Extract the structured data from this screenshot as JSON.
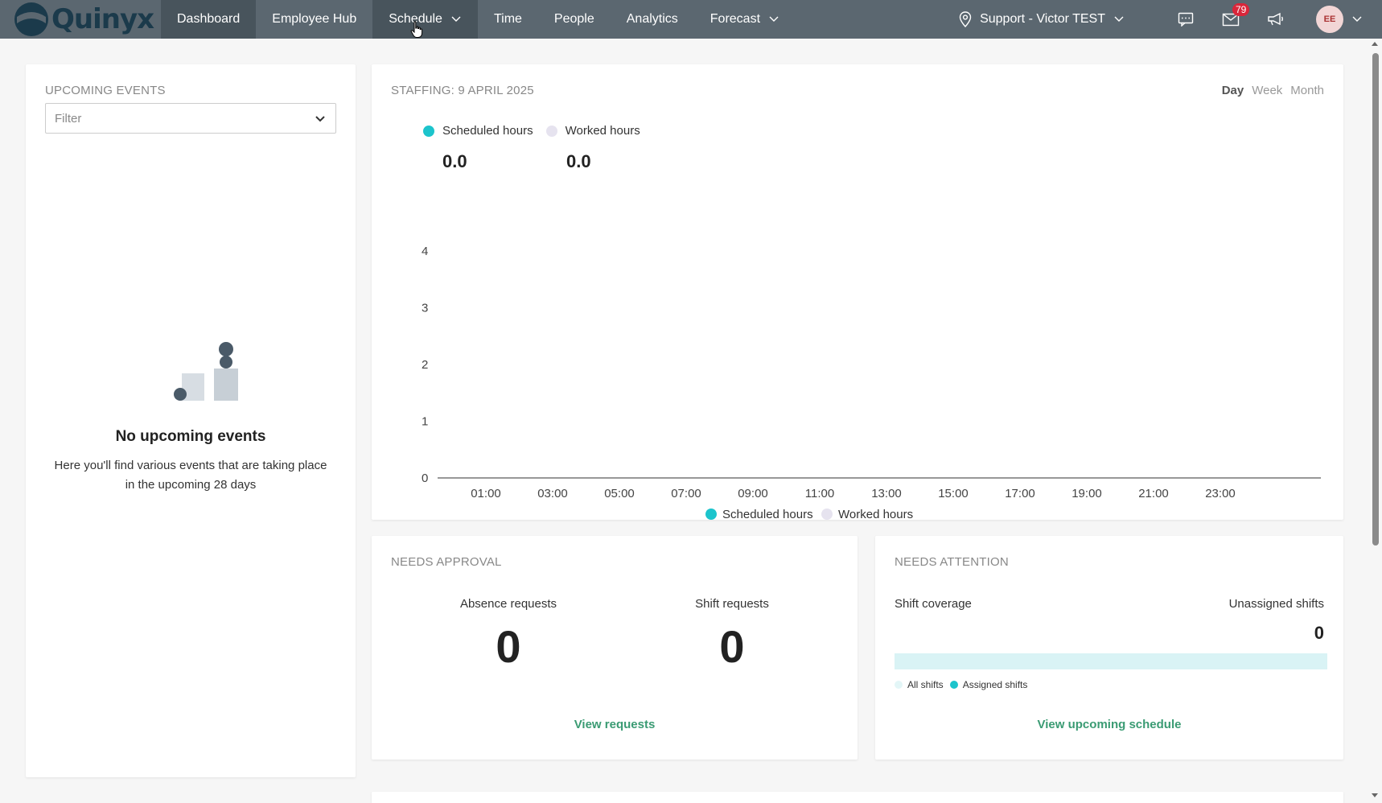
{
  "app": {
    "logo_text": "Quinyx"
  },
  "nav": {
    "items": [
      {
        "label": "Dashboard",
        "active": true,
        "dropdown": false
      },
      {
        "label": "Employee Hub",
        "active": false,
        "dropdown": false
      },
      {
        "label": "Schedule",
        "active": false,
        "dropdown": true
      },
      {
        "label": "Time",
        "active": false,
        "dropdown": false
      },
      {
        "label": "People",
        "active": false,
        "dropdown": false
      },
      {
        "label": "Analytics",
        "active": false,
        "dropdown": false
      },
      {
        "label": "Forecast",
        "active": false,
        "dropdown": true
      }
    ],
    "location": "Support - Victor TEST",
    "messages_badge": "79",
    "avatar_initials": "EE"
  },
  "events": {
    "title": "UPCOMING EVENTS",
    "filter_placeholder": "Filter",
    "empty_title": "No upcoming events",
    "empty_text": "Here you'll find various events that are taking place in the upcoming 28 days"
  },
  "staffing": {
    "title": "STAFFING: 9 APRIL 2025",
    "periods": [
      "Day",
      "Week",
      "Month"
    ],
    "active_period": "Day",
    "legend": [
      {
        "name": "Scheduled hours",
        "color": "#1cc4cc",
        "total": "0.0"
      },
      {
        "name": "Worked hours",
        "color": "#e6e3ef",
        "total": "0.0"
      }
    ]
  },
  "chart_data": {
    "type": "line",
    "title": "",
    "xlabel": "",
    "ylabel": "",
    "x": [
      "01:00",
      "03:00",
      "05:00",
      "07:00",
      "09:00",
      "11:00",
      "13:00",
      "15:00",
      "17:00",
      "19:00",
      "21:00",
      "23:00"
    ],
    "ylim": [
      0,
      4
    ],
    "y_ticks": [
      "0",
      "1",
      "2",
      "3",
      "4"
    ],
    "series": [
      {
        "name": "Scheduled hours",
        "color": "#1cc4cc",
        "values": [
          0,
          0,
          0,
          0,
          0,
          0,
          0,
          0,
          0,
          0,
          0,
          0
        ]
      },
      {
        "name": "Worked hours",
        "color": "#e6e3ef",
        "values": [
          0,
          0,
          0,
          0,
          0,
          0,
          0,
          0,
          0,
          0,
          0,
          0
        ]
      }
    ],
    "legend_position": "bottom",
    "grid": false
  },
  "approval": {
    "title": "NEEDS APPROVAL",
    "absence_label": "Absence requests",
    "absence_value": "0",
    "shift_label": "Shift requests",
    "shift_value": "0",
    "link": "View requests"
  },
  "attention": {
    "title": "NEEDS ATTENTION",
    "coverage_label": "Shift coverage",
    "unassigned_label": "Unassigned shifts",
    "unassigned_value": "0",
    "coverage_fraction": 0,
    "legend_all": "All shifts",
    "legend_assigned": "Assigned shifts",
    "color_all": "#e3f6f7",
    "color_assigned": "#1cc4cc",
    "link": "View upcoming schedule"
  }
}
